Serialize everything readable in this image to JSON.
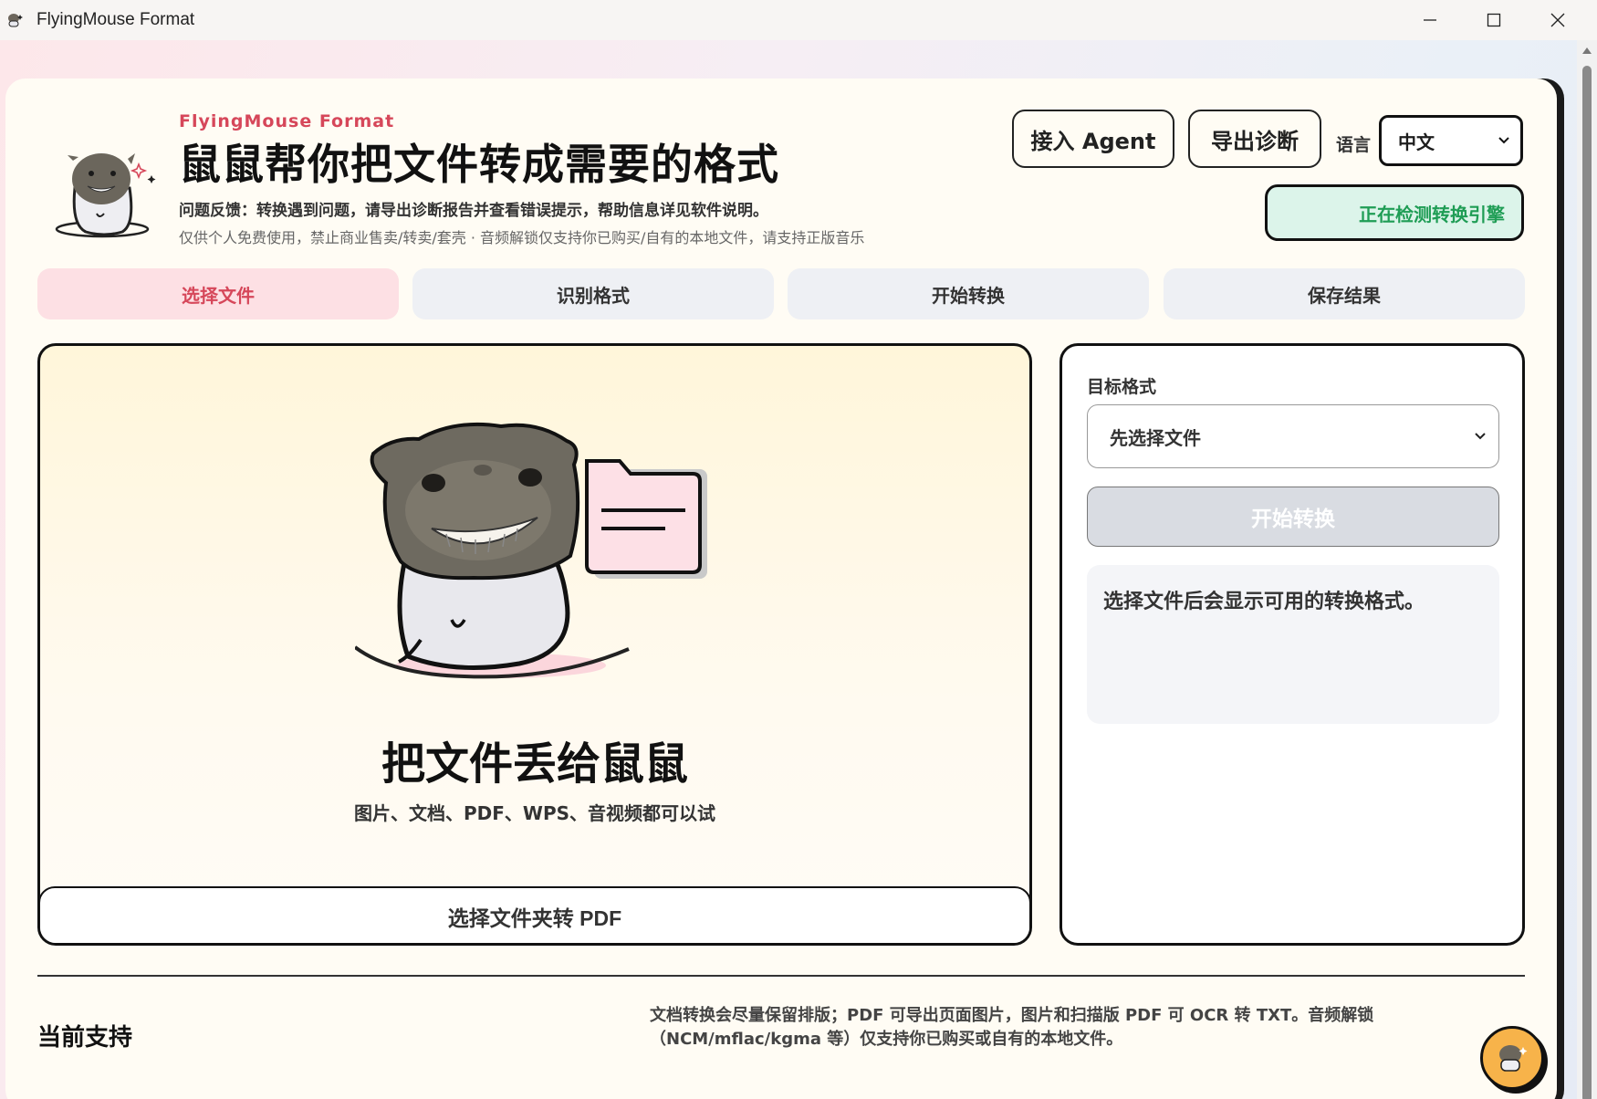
{
  "window": {
    "title": "FlyingMouse Format"
  },
  "header": {
    "brand": "FlyingMouse Format",
    "headline": "鼠鼠帮你把文件转成需要的格式",
    "feedback": "问题反馈：转换遇到问题，请导出诊断报告并查看错误提示，帮助信息详见软件说明。",
    "notice": "仅供个人免费使用，禁止商业售卖/转卖/套壳 · 音频解锁仅支持你已购买/自有的本地文件，请支持正版音乐",
    "agent_button": "接入 Agent",
    "diagnostics_button": "导出诊断",
    "language_label": "语言",
    "language_value": "中文",
    "engine_status": "正在检测转换引擎"
  },
  "steps": [
    {
      "label": "选择文件",
      "active": true
    },
    {
      "label": "识别格式",
      "active": false
    },
    {
      "label": "开始转换",
      "active": false
    },
    {
      "label": "保存结果",
      "active": false
    }
  ],
  "dropzone": {
    "title": "把文件丢给鼠鼠",
    "subtitle": "图片、文档、PDF、WPS、音视频都可以试",
    "folder_button": "选择文件夹转 PDF"
  },
  "panel": {
    "target_label": "目标格式",
    "target_value": "先选择文件",
    "convert_button": "开始转换",
    "hint": "选择文件后会显示可用的转换格式。"
  },
  "footer": {
    "support_title": "当前支持",
    "support_desc": "文档转换会尽量保留排版；PDF 可导出页面图片，图片和扫描版 PDF 可 OCR 转 TXT。音频解锁（NCM/mflac/kgma 等）仅支持你已购买或自有的本地文件。"
  },
  "colors": {
    "accent": "#d6475a",
    "success": "#1f9d55",
    "card_bg": "#fffcf4",
    "step_active_bg": "#fde0e4",
    "fab": "#f7b34a"
  },
  "icons": [
    "app-icon",
    "minimize-icon",
    "maximize-icon",
    "close-icon",
    "chevron-down-icon",
    "mascot-icon",
    "folder-icon",
    "sparkle-icon"
  ]
}
